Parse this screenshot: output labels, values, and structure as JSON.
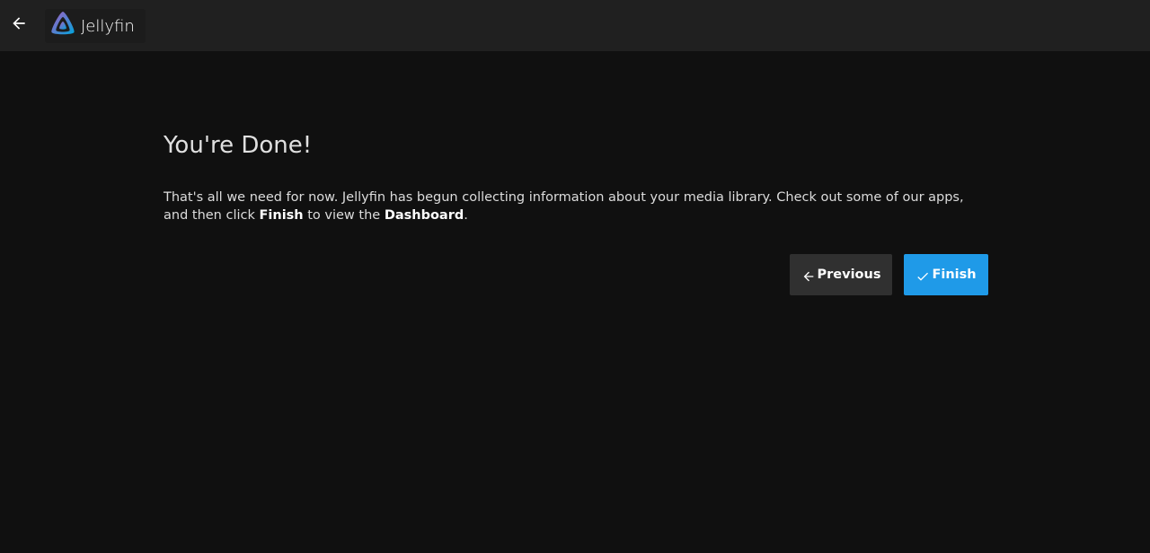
{
  "header": {
    "brand": "Jellyfin",
    "back_icon": "arrow-left-icon",
    "logo_icon": "jellyfin-logo-icon"
  },
  "main": {
    "title": "You're Done!",
    "text_part1": "That's all we need for now. Jellyfin has begun collecting information about your media library. Check out some of our apps, and then click ",
    "text_bold1": "Finish",
    "text_part2": " to view the ",
    "text_bold2": "Dashboard",
    "text_part3": "."
  },
  "buttons": {
    "previous_label": "Previous",
    "previous_icon": "arrow-left-icon",
    "finish_label": "Finish",
    "finish_icon": "check-icon"
  },
  "colors": {
    "background": "#101010",
    "header": "#202020",
    "accent": "#1f9ae8",
    "secondary_button": "#303030"
  }
}
